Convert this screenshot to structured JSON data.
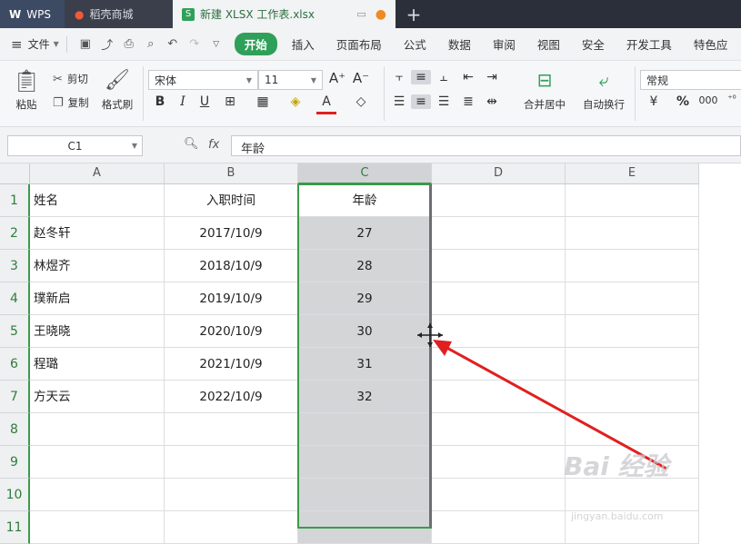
{
  "tabs": [
    {
      "label": "WPS",
      "icon": "wps-logo-icon"
    },
    {
      "label": "稻壳商城",
      "icon": "docer-icon"
    },
    {
      "label": "新建 XLSX 工作表.xlsx",
      "icon": "sheet-icon"
    }
  ],
  "menu": {
    "file": "文件",
    "items": [
      "开始",
      "插入",
      "页面布局",
      "公式",
      "数据",
      "审阅",
      "视图",
      "安全",
      "开发工具",
      "特色应"
    ]
  },
  "ribbon": {
    "paste": "粘贴",
    "cut": "剪切",
    "copy": "复制",
    "format_painter": "格式刷",
    "font_name": "宋体",
    "font_size": "11",
    "merge_center": "合并居中",
    "wrap_text": "自动换行",
    "number_format": "常规"
  },
  "formula_bar": {
    "name_box": "C1",
    "fx": "fx",
    "content": "年龄"
  },
  "columns": [
    "A",
    "B",
    "C",
    "D",
    "E"
  ],
  "rows": [
    "1",
    "2",
    "3",
    "4",
    "5",
    "6",
    "7",
    "8",
    "9",
    "10",
    "11"
  ],
  "cells": [
    [
      "姓名",
      "入职时间",
      "年龄"
    ],
    [
      "赵冬轩",
      "2017/10/9",
      "27"
    ],
    [
      "林煜齐",
      "2018/10/9",
      "28"
    ],
    [
      "璞新启",
      "2019/10/9",
      "29"
    ],
    [
      "王晓晓",
      "2020/10/9",
      "30"
    ],
    [
      "程璐",
      "2021/10/9",
      "31"
    ],
    [
      "方天云",
      "2022/10/9",
      "32"
    ]
  ],
  "watermark": "Bai 经验",
  "watermark_sub": "jingyan.baidu.com",
  "colors": {
    "accent": "#2fa05a",
    "arrow": "#e02020"
  }
}
